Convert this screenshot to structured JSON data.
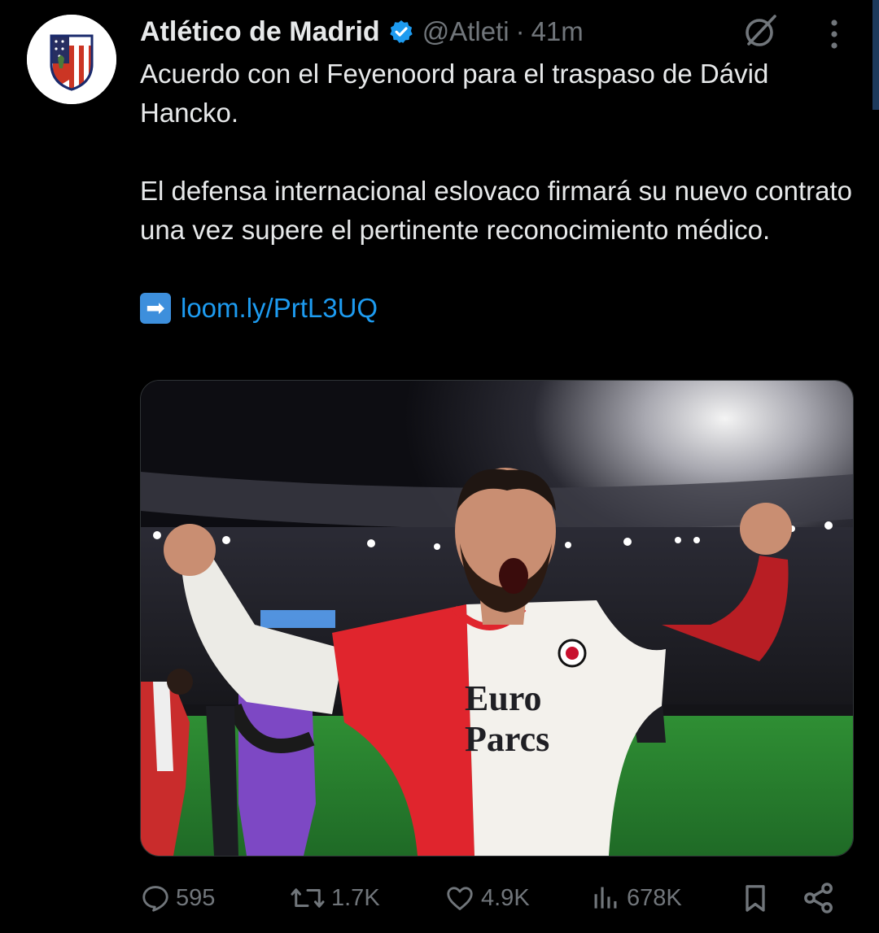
{
  "tweet": {
    "display_name": "Atlético de Madrid",
    "handle": "@Atleti",
    "separator": "·",
    "time": "41m",
    "paragraphs": [
      "Acuerdo con el Feyenoord para el traspaso de Dávid Hancko.",
      "El defensa internacional eslovaco firmará su nuevo contrato una vez supere el pertinente reconocimiento médico."
    ],
    "link_emoji": "➡",
    "link_text": "loom.ly/PrtL3UQ",
    "media": {
      "shirt_sponsor_line1": "Euro",
      "shirt_sponsor_line2": "Parcs"
    }
  },
  "actions": {
    "replies": "595",
    "reposts": "1.7K",
    "likes": "4.9K",
    "views": "678K"
  },
  "colors": {
    "background": "#000000",
    "text": "#e7e9ea",
    "muted": "#71767b",
    "link": "#1d9bf0",
    "verified": "#1d9bf0"
  },
  "icons": [
    "verified-badge-icon",
    "grok-icon",
    "more-icon",
    "reply-icon",
    "repost-icon",
    "like-icon",
    "views-icon",
    "bookmark-icon",
    "share-icon"
  ]
}
